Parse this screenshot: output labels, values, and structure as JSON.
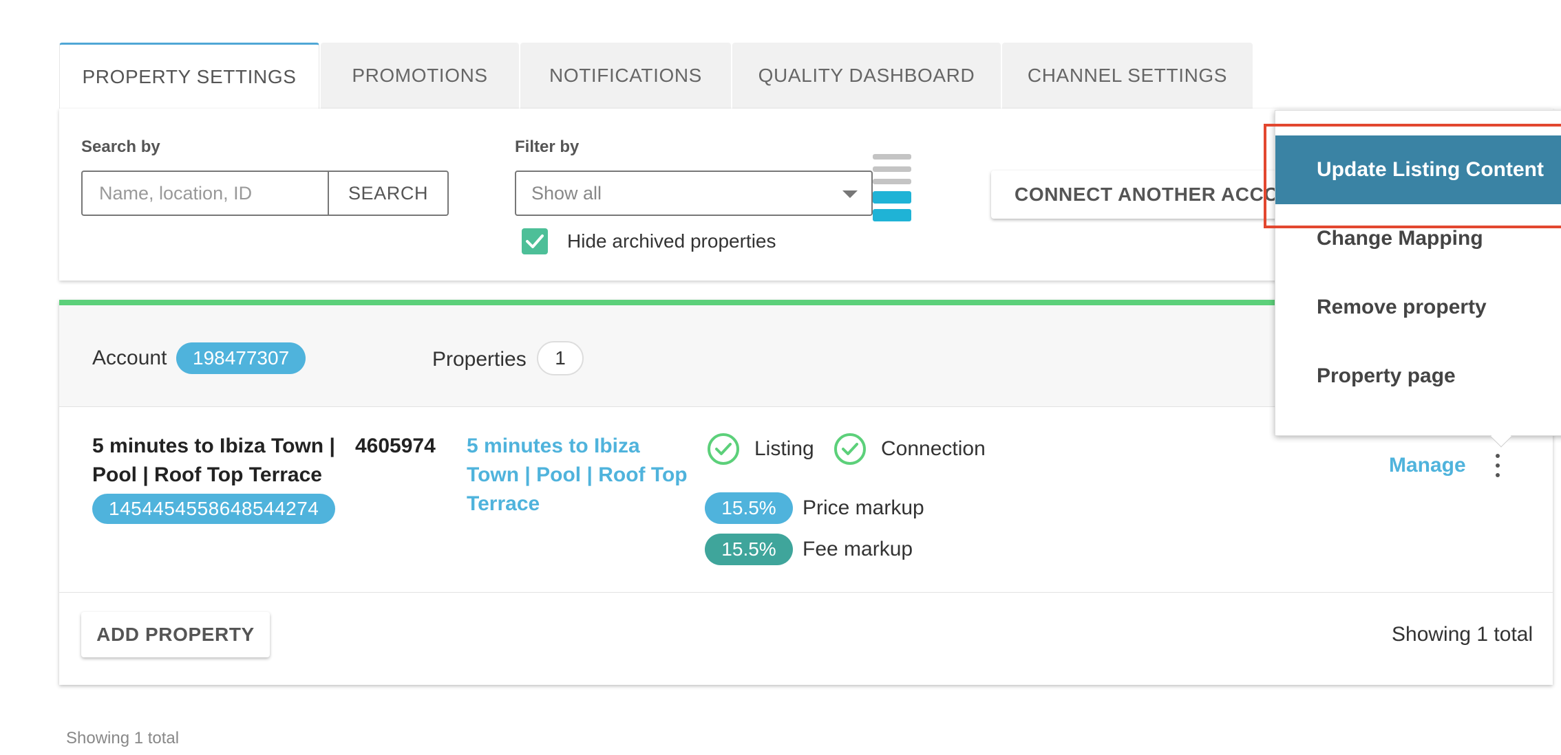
{
  "tabs": [
    "PROPERTY SETTINGS",
    "PROMOTIONS",
    "NOTIFICATIONS",
    "QUALITY DASHBOARD",
    "CHANNEL SETTINGS"
  ],
  "filters": {
    "search_label": "Search by",
    "search_placeholder": "Name, location, ID",
    "search_button": "SEARCH",
    "filter_label": "Filter by",
    "filter_value": "Show all",
    "hide_archived_label": "Hide archived properties",
    "hide_archived_checked": true,
    "connect_button": "CONNECT ANOTHER ACCOUNT"
  },
  "account": {
    "label": "Account",
    "id": "198477307",
    "properties_label": "Properties",
    "properties_count": "1"
  },
  "property": {
    "name": "5 minutes to Ibiza Town | Pool | Roof Top Terrace",
    "external_id": "1454454558648544274",
    "number": "4605974",
    "link_text": "5 minutes to Ibiza Town | Pool | Roof Top Terrace",
    "listing_label": "Listing",
    "connection_label": "Connection",
    "price_markup_value": "15.5%",
    "price_markup_label": "Price markup",
    "fee_markup_value": "15.5%",
    "fee_markup_label": "Fee markup",
    "manage_label": "Manage"
  },
  "card_footer": {
    "add_property_button": "ADD PROPERTY",
    "showing_text": "Showing 1 total"
  },
  "page_footer": {
    "showing_text": "Showing 1 total"
  },
  "menu": {
    "items": [
      "Update Listing Content",
      "Change Mapping",
      "Remove property",
      "Property page"
    ]
  },
  "colors": {
    "accent_blue": "#4fb3dc",
    "menu_highlight": "#3a83a4",
    "success_green": "#5cd07a",
    "checkbox_green": "#4dbf98",
    "fee_teal": "#3fa59b",
    "highlight_red": "#e2472f"
  },
  "icons": [
    "check-circle-icon",
    "chevron-down-icon",
    "kebab-menu-icon",
    "stacked-bars-icon",
    "checkmark-icon"
  ]
}
